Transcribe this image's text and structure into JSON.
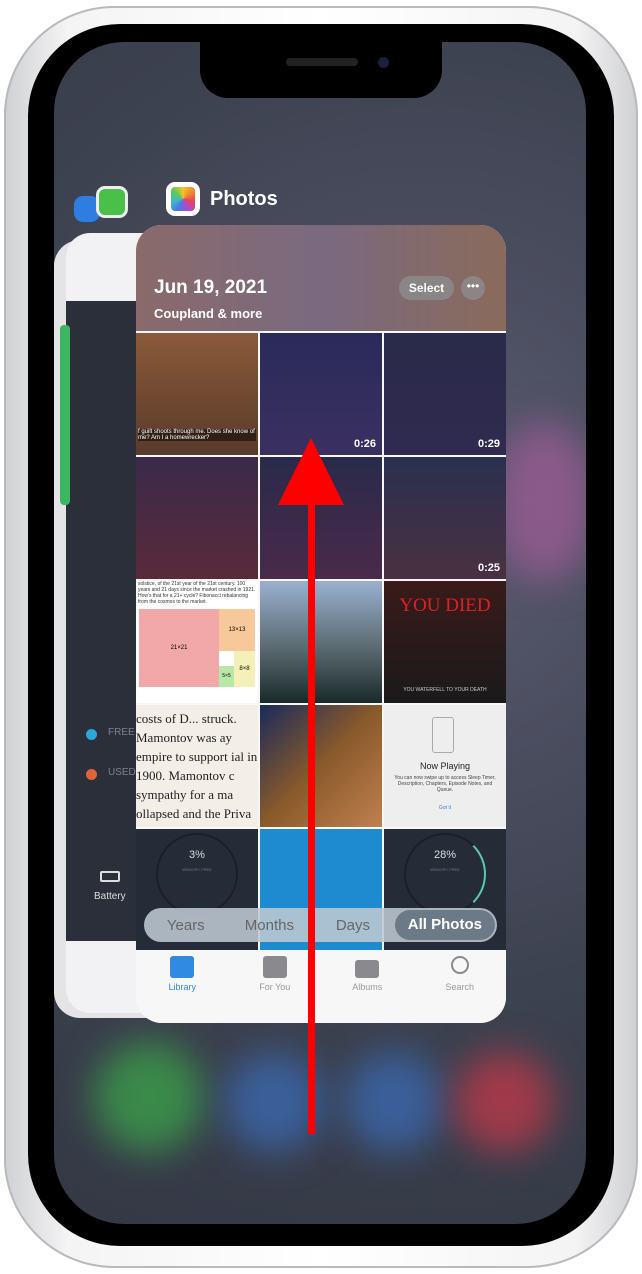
{
  "switcher": {
    "front_app_name": "Photos",
    "back_card": {
      "legend": [
        "FREE",
        "USED"
      ],
      "battery_label": "Battery",
      "colors": {
        "free": "#2aa6d9",
        "used": "#e0643a"
      }
    }
  },
  "photos": {
    "header": {
      "date": "Jun 19, 2021",
      "subtitle": "Coupland & more",
      "select_label": "Select",
      "more_label": "•••"
    },
    "tiles": [
      {
        "text": "f guilt shoots through me. Does she know of me? Am I a homewrecker?"
      },
      {
        "duration": "0:26"
      },
      {
        "duration": "0:29"
      },
      {},
      {},
      {
        "duration": "0:25"
      },
      {
        "text": "solstice, of the 21st year of the 21st century. 100 years and 21 days since the market crashed in 1921. How's that for a 21+ cycle? Fibonacci rebalancing from the cosmos to the market.",
        "labels": [
          "21×21",
          "13×13",
          "8×8",
          "5×5"
        ]
      },
      {},
      {
        "title": "YOU DIED",
        "caption": "YOU WATERFELL TO YOUR DEATH"
      },
      {
        "text": "costs of D... struck. Mamontov was ay empire to support ial in 1900. Mamontov c sympathy for a ma ollapsed and the Priva red bankrupt and"
      },
      {},
      {
        "title": "Now Playing",
        "body": "You can now swipe up to access Sleep Timer, Description, Chapters, Episode Notes, and Queue.",
        "link": "Got it"
      },
      {
        "value": "3%",
        "caption": "MEMORY FREE"
      },
      {},
      {
        "value": "28%",
        "caption": "MEMORY FREE"
      }
    ],
    "segments": [
      "Years",
      "Months",
      "Days",
      "All Photos"
    ],
    "active_segment": "All Photos",
    "tabs": [
      {
        "label": "Library",
        "icon": "photo-library-icon"
      },
      {
        "label": "For You",
        "icon": "for-you-icon"
      },
      {
        "label": "Albums",
        "icon": "albums-icon"
      },
      {
        "label": "Search",
        "icon": "search-icon"
      }
    ],
    "active_tab": "Library",
    "accent": "#2f8ae0"
  },
  "gesture_arrow": {
    "direction": "up",
    "color": "#ff0000"
  }
}
